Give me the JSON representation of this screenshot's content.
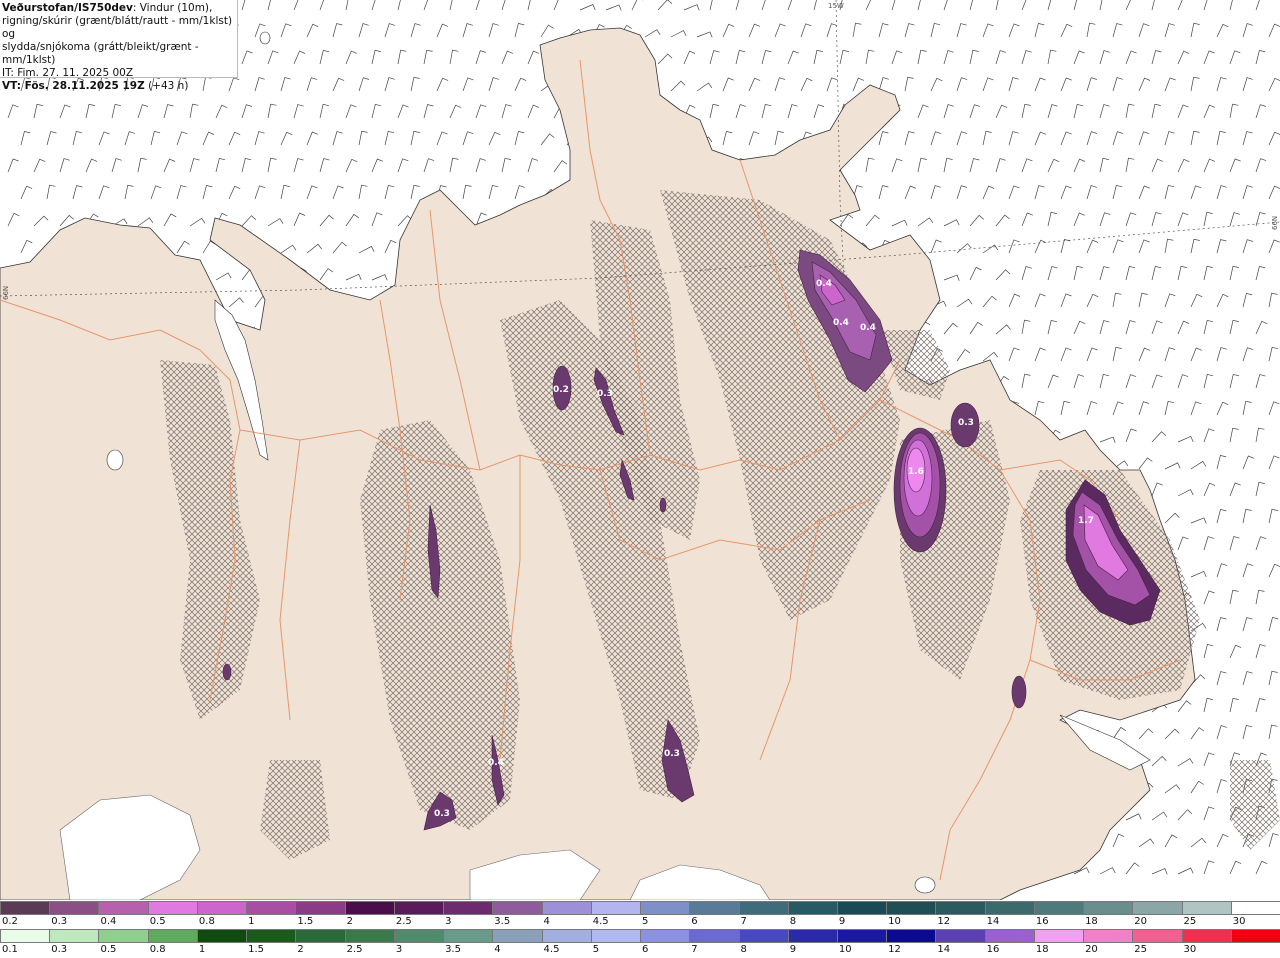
{
  "header": {
    "source": "Veðurstofan/IS750dev",
    "desc_line1": ": Vindur (10m),",
    "desc_line2": "rigning/skúrir (grænt/blátt/rautt - mm/1klst) og",
    "desc_line3": "slydda/snjókoma (grátt/bleikt/grænt - mm/1klst)",
    "it": "IT: Fim. 27. 11. 2025 00Z",
    "vt_label": "VT: Fös. 28.11.2025 19Z",
    "vt_offset": " (+43 h)"
  },
  "graticule": {
    "lon_label": "15W",
    "lat_label_left": "66N",
    "lat_label_right": "66N"
  },
  "precip_labels": [
    "0.4",
    "0.4",
    "0.4",
    "0.3",
    "1.6",
    "1.7",
    "0.2",
    "0.3",
    "0.3",
    "0.3",
    "0.4"
  ],
  "legend_snow": {
    "colors": [
      "#5a3a55",
      "#8a4f84",
      "#b760ad",
      "#e07ae0",
      "#cc66cc",
      "#a94fa3",
      "#8a3d86",
      "#4a0f4a",
      "#5b1a5b",
      "#6e2a6e",
      "#8e5c9c",
      "#9e90d6",
      "#b4b4f0",
      "#7f8fc8",
      "#5a7a9a",
      "#3e6c7a",
      "#285a66",
      "#1a4a55",
      "#1f4f55",
      "#2b5b5e",
      "#3a6a6c",
      "#4f7a7c",
      "#6a8e8e",
      "#8aa6a6",
      "#b0c4c4",
      "#ffffff"
    ],
    "labels": [
      "0.2",
      "0.3",
      "0.4",
      "0.5",
      "0.8",
      "1",
      "1.5",
      "2",
      "2.5",
      "3",
      "3.5",
      "4",
      "4.5",
      "5",
      "6",
      "7",
      "8",
      "9",
      "10",
      "12",
      "14",
      "16",
      "18",
      "20",
      "25",
      "30"
    ]
  },
  "legend_rain": {
    "colors": [
      "#e8fce8",
      "#bfe8bf",
      "#8fcf8f",
      "#5faa5f",
      "#0f4a0f",
      "#1a5a1a",
      "#2a6a3a",
      "#3a7a4a",
      "#4f8a6a",
      "#6a9a8a",
      "#8aa0b8",
      "#a0aee0",
      "#b0b8f0",
      "#8c90e0",
      "#6a6ad0",
      "#4848c0",
      "#2a2aa8",
      "#1818a0",
      "#0a0a90",
      "#5a40b0",
      "#9a60d0",
      "#f0a0f0",
      "#f080c8",
      "#f06090",
      "#f03050",
      "#f00010"
    ],
    "labels": [
      "0.1",
      "0.3",
      "0.5",
      "0.8",
      "1",
      "1.5",
      "2",
      "2.5",
      "3",
      "3.5",
      "4",
      "4.5",
      "5",
      "6",
      "7",
      "8",
      "9",
      "10",
      "12",
      "14",
      "16",
      "18",
      "20",
      "25",
      "30"
    ]
  }
}
